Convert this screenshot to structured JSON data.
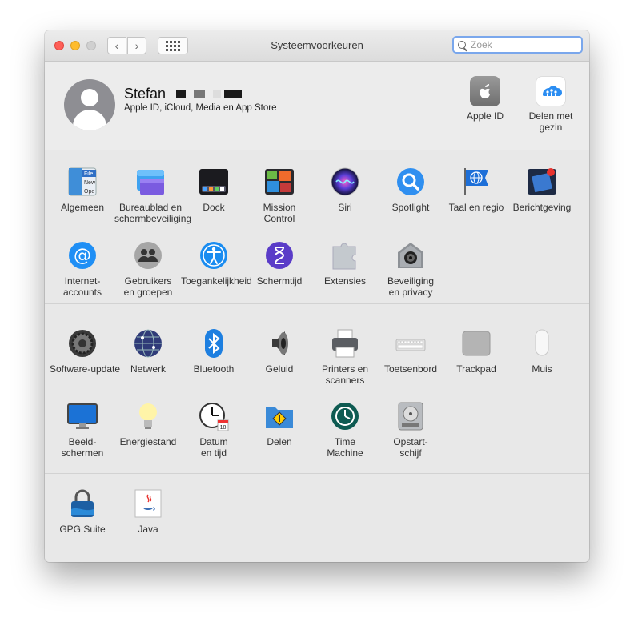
{
  "window": {
    "title": "Systeemvoorkeuren",
    "search_placeholder": "Zoek",
    "back_glyph": "‹",
    "forward_glyph": "›"
  },
  "user": {
    "name": "Stefan",
    "subtitle": "Apple ID, iCloud, Media en App Store"
  },
  "top_items": [
    {
      "label": "Apple ID",
      "icon": "apple-logo-icon"
    },
    {
      "label": "Delen met gezin",
      "icon": "family-sharing-icon"
    }
  ],
  "section1": [
    {
      "label": "Algemeen",
      "icon": "general-icon"
    },
    {
      "label": "Bureaublad en schermbeveiliging",
      "icon": "desktop-screensaver-icon"
    },
    {
      "label": "Dock",
      "icon": "dock-icon"
    },
    {
      "label": "Mission Control",
      "icon": "mission-control-icon"
    },
    {
      "label": "Siri",
      "icon": "siri-icon"
    },
    {
      "label": "Spotlight",
      "icon": "spotlight-icon"
    },
    {
      "label": "Taal en regio",
      "icon": "language-region-icon"
    },
    {
      "label": "Berichtgeving",
      "icon": "notifications-icon"
    },
    {
      "label": "Internet-accounts",
      "icon": "internet-accounts-icon"
    },
    {
      "label": "Gebruikers en groepen",
      "icon": "users-groups-icon"
    },
    {
      "label": "Toegankelijkheid",
      "icon": "accessibility-icon"
    },
    {
      "label": "Schermtijd",
      "icon": "screen-time-icon"
    },
    {
      "label": "Extensies",
      "icon": "extensions-icon"
    },
    {
      "label": "Beveiliging en privacy",
      "icon": "security-privacy-icon"
    }
  ],
  "section2": [
    {
      "label": "Software-update",
      "icon": "software-update-icon"
    },
    {
      "label": "Netwerk",
      "icon": "network-icon"
    },
    {
      "label": "Bluetooth",
      "icon": "bluetooth-icon"
    },
    {
      "label": "Geluid",
      "icon": "sound-icon"
    },
    {
      "label": "Printers en scanners",
      "icon": "printers-icon"
    },
    {
      "label": "Toetsenbord",
      "icon": "keyboard-icon"
    },
    {
      "label": "Trackpad",
      "icon": "trackpad-icon"
    },
    {
      "label": "Muis",
      "icon": "mouse-icon"
    },
    {
      "label": "Beeld-schermen",
      "icon": "displays-icon"
    },
    {
      "label": "Energiestand",
      "icon": "energy-saver-icon"
    },
    {
      "label": "Datum en tijd",
      "icon": "date-time-icon"
    },
    {
      "label": "Delen",
      "icon": "sharing-icon"
    },
    {
      "label": "Time Machine",
      "icon": "time-machine-icon"
    },
    {
      "label": "Opstart-schijf",
      "icon": "startup-disk-icon"
    }
  ],
  "section3": [
    {
      "label": "GPG Suite",
      "icon": "gpg-suite-icon"
    },
    {
      "label": "Java",
      "icon": "java-icon"
    }
  ],
  "icon_glyphs": {
    "extra_calendar_day": "18",
    "general_tag": "File",
    "general_sub": "New",
    "general_sub2": "Ope"
  }
}
